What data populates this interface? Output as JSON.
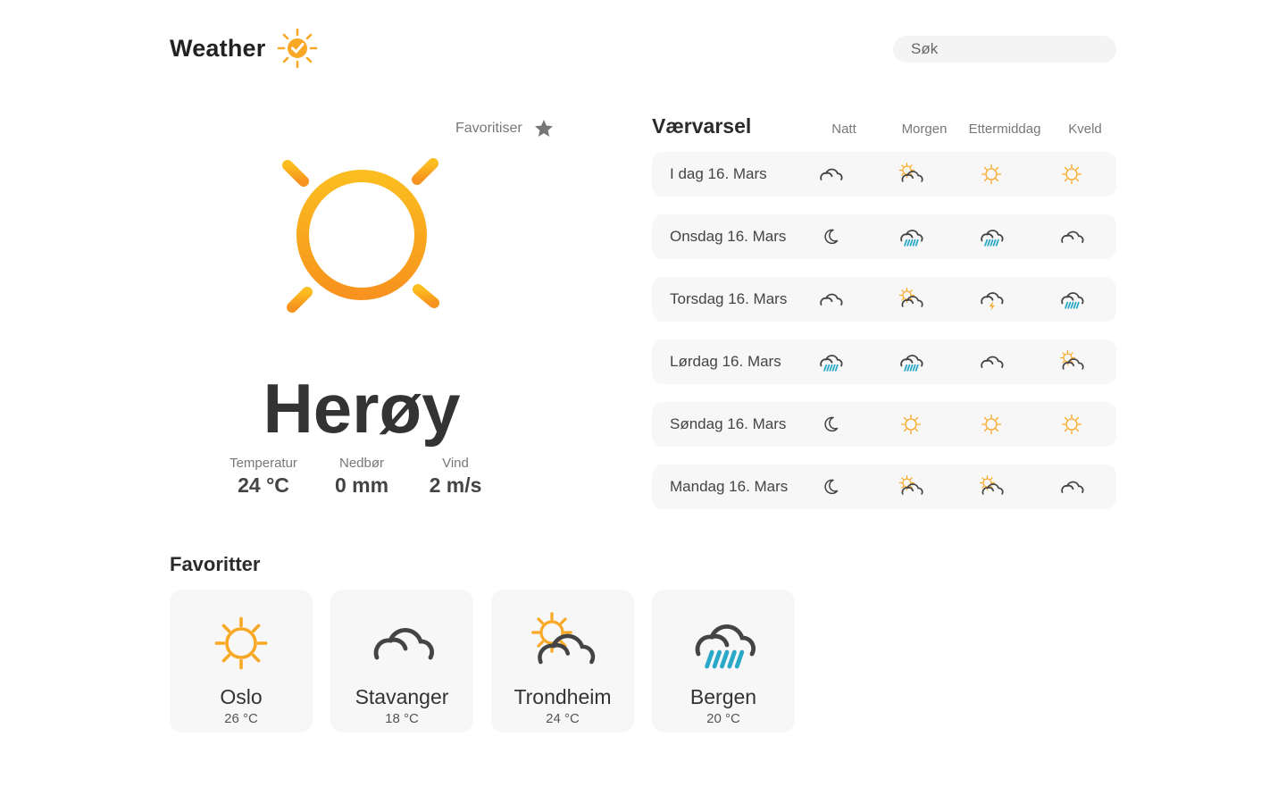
{
  "header": {
    "title": "Weather",
    "logo_icon": "sun-check-icon",
    "search_placeholder": "Søk"
  },
  "hero": {
    "favorite_label": "Favoritiser",
    "city": "Herøy",
    "condition_icon": "sun-icon",
    "stats": [
      {
        "label": "Temperatur",
        "value": "24 °C"
      },
      {
        "label": "Nedbør",
        "value": "0 mm"
      },
      {
        "label": "Vind",
        "value": "2 m/s"
      }
    ]
  },
  "forecast": {
    "title": "Værvarsel",
    "columns": [
      "Natt",
      "Morgen",
      "Ettermiddag",
      "Kveld"
    ],
    "rows": [
      {
        "day": "I dag 16. Mars",
        "icons": [
          "cloud",
          "sun-cloud",
          "sun",
          "sun"
        ]
      },
      {
        "day": "Onsdag 16. Mars",
        "icons": [
          "moon",
          "rain",
          "rain",
          "cloud"
        ]
      },
      {
        "day": "Torsdag 16. Mars",
        "icons": [
          "cloud",
          "sun-cloud",
          "thunder",
          "rain"
        ]
      },
      {
        "day": "Lørdag 16. Mars",
        "icons": [
          "rain",
          "rain",
          "cloud",
          "sun-cloud"
        ]
      },
      {
        "day": "Søndag 16. Mars",
        "icons": [
          "moon",
          "sun",
          "sun",
          "sun"
        ]
      },
      {
        "day": "Mandag 16. Mars",
        "icons": [
          "moon",
          "sun-cloud",
          "sun-cloud",
          "cloud"
        ]
      }
    ]
  },
  "favorites": {
    "title": "Favoritter",
    "items": [
      {
        "city": "Oslo",
        "temp": "26 °C",
        "icon": "sun"
      },
      {
        "city": "Stavanger",
        "temp": "18 °C",
        "icon": "cloud"
      },
      {
        "city": "Trondheim",
        "temp": "24 °C",
        "icon": "sun-cloud"
      },
      {
        "city": "Bergen",
        "temp": "20 °C",
        "icon": "rain"
      }
    ]
  },
  "colors": {
    "sun": "#f9a825",
    "cloud": "#444444",
    "rain": "#29a8c7",
    "card_bg": "#f7f7f7",
    "star": "#777777"
  }
}
